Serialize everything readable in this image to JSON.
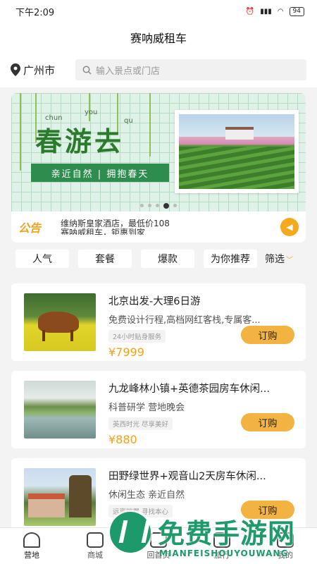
{
  "status_bar": {
    "time": "下午2:09",
    "battery": "94"
  },
  "app": {
    "title": "赛呐威租车"
  },
  "location": {
    "city": "广州市"
  },
  "search": {
    "placeholder": "输入景点或门店"
  },
  "banner": {
    "title": "春游去",
    "pinyin": [
      "chun",
      "you",
      "qu"
    ],
    "tagline": "亲近自然 | 拥抱春天",
    "page_count": 5,
    "active_index": 3
  },
  "notice": {
    "badge": "公告",
    "lines": [
      "维纳斯皇家酒店，最低价108",
      "赛呐威租车，钜惠到家"
    ]
  },
  "tabs": [
    "人气",
    "套餐",
    "爆款",
    "为你推荐"
  ],
  "filter_label": "筛选",
  "products": [
    {
      "title": "北京出发-大理6日游",
      "subtitle": "免费设计行程,高档网红客栈,专属客...",
      "tag": "24小时贴身服务",
      "price": "¥7999",
      "button": "订购"
    },
    {
      "title": "九龙峰林小镇+英德茶园房车休闲...",
      "subtitle": "科普研学 营地晚会",
      "tag": "英西时光 尽享美好",
      "price": "¥880",
      "button": "订购"
    },
    {
      "title": "田野绿世界+观音山2天房车休闲...",
      "subtitle": "休闲生态 亲近自然",
      "tag": "远离喧嚣 寻找本心",
      "price": "",
      "button": "订购"
    }
  ],
  "nav": [
    {
      "label": "营地",
      "icon": "tent-icon"
    },
    {
      "label": "商城",
      "icon": "shop-icon"
    },
    {
      "label": "回首页",
      "icon": "home-icon"
    },
    {
      "label": "旅行",
      "icon": "luggage-icon"
    },
    {
      "label": "我的",
      "icon": "profile-icon"
    }
  ],
  "watermark": {
    "text": "免费手游网",
    "sub": "MIANFEISHOUYOUWANG"
  }
}
